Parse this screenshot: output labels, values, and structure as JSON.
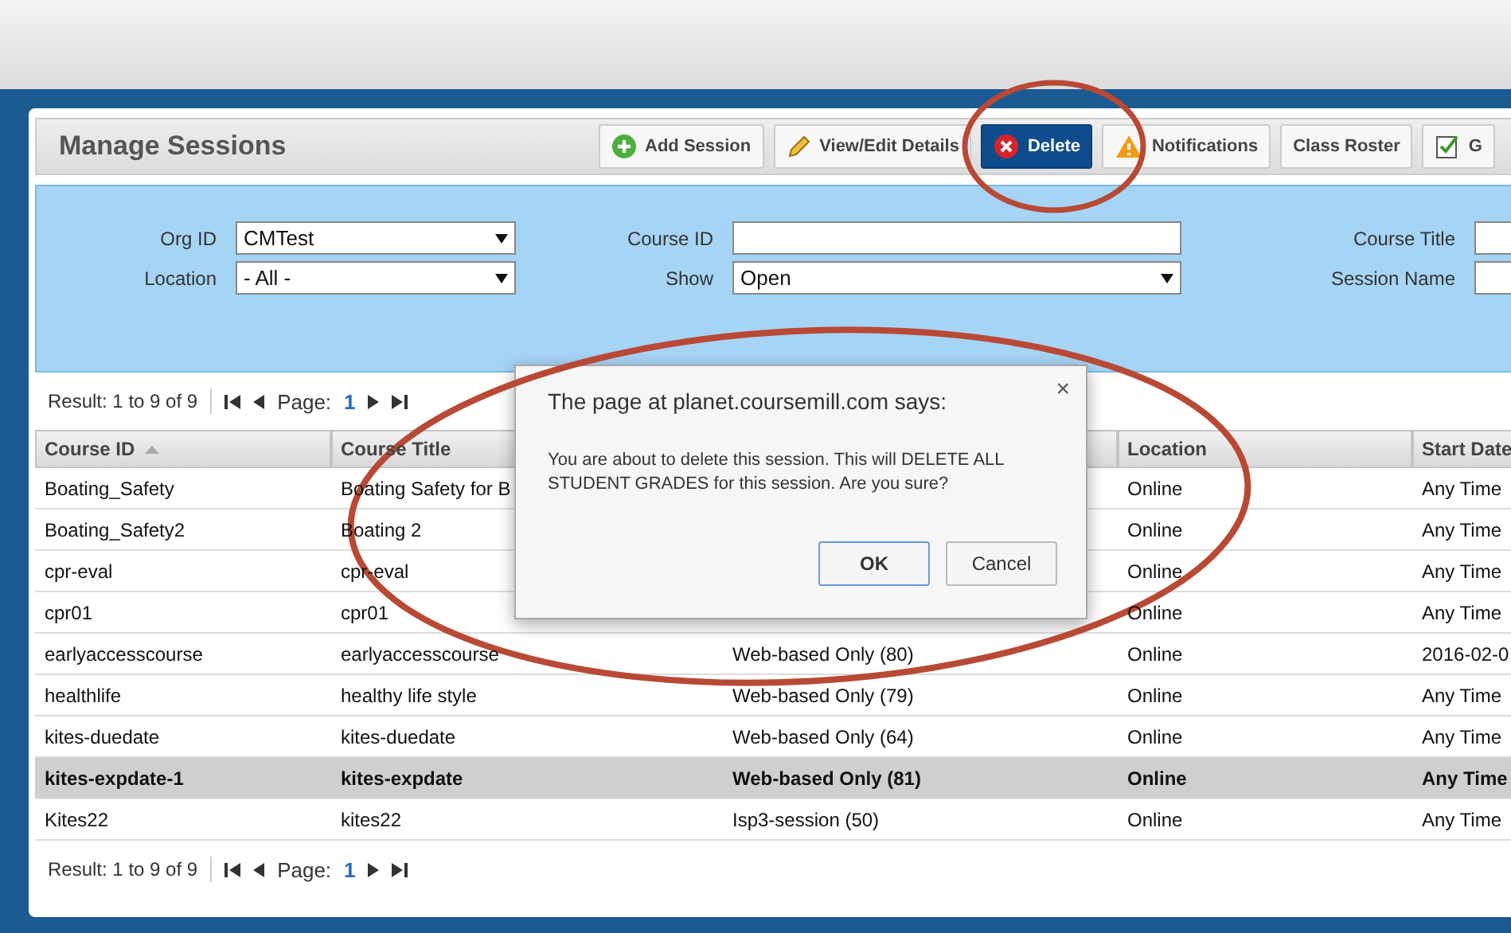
{
  "page_title": "Manage Sessions",
  "toolbar": [
    {
      "label": "Add Session",
      "selected": false
    },
    {
      "label": "View/Edit Details",
      "selected": false
    },
    {
      "label": "Delete",
      "selected": true
    },
    {
      "label": "Notifications",
      "selected": false
    },
    {
      "label": "Class Roster",
      "selected": false
    },
    {
      "label": "G",
      "selected": false
    }
  ],
  "filters": [
    {
      "label": "Org ID",
      "kind": "select",
      "value": "CMTest"
    },
    {
      "label": "Course ID",
      "kind": "input"
    },
    {
      "label": "Course Title",
      "kind": "input"
    },
    {
      "label": "Location",
      "kind": "select",
      "value": "- All -"
    },
    {
      "label": "Show",
      "kind": "select",
      "value": "Open"
    },
    {
      "label": "Session Name",
      "kind": "input"
    }
  ],
  "pager_top": {
    "result": "Result: 1 to 9 of 9",
    "page_label": "Page:",
    "page": "1"
  },
  "table": {
    "columns": [
      {
        "label": "Course ID",
        "sorted": true
      },
      {
        "label": "Course Title",
        "sorted": false
      },
      {},
      {
        "label": "Location",
        "sorted": false
      },
      {
        "label": "Start Date"
      }
    ],
    "rows": [
      {
        "cells": [
          "Boating_Safety",
          "Boating Safety for B",
          "",
          "Online",
          "Any Time"
        ],
        "selected": false
      },
      {
        "cells": [
          "Boating_Safety2",
          "Boating 2",
          "",
          "Online",
          "Any Time"
        ],
        "selected": false
      },
      {
        "cells": [
          "cpr-eval",
          "cpr-eval",
          "",
          "Online",
          "Any Time"
        ],
        "selected": false
      },
      {
        "cells": [
          "cpr01",
          "cpr01",
          "",
          "Online",
          "Any Time"
        ],
        "selected": false
      },
      {
        "cells": [
          "earlyaccesscourse",
          "earlyaccesscourse",
          "Web-based Only (80)",
          "Online",
          "2016-02-0"
        ],
        "selected": false
      },
      {
        "cells": [
          "healthlife",
          "healthy life style",
          "Web-based Only (79)",
          "Online",
          "Any Time"
        ],
        "selected": false
      },
      {
        "cells": [
          "kites-duedate",
          "kites-duedate",
          "Web-based Only (64)",
          "Online",
          "Any Time"
        ],
        "selected": false
      },
      {
        "cells": [
          "kites-expdate-1",
          "kites-expdate",
          "Web-based Only (81)",
          "Online",
          "Any Time"
        ],
        "selected": true
      },
      {
        "cells": [
          "Kites22",
          "kites22",
          "Isp3-session (50)",
          "Online",
          "Any Time"
        ],
        "selected": false
      }
    ]
  },
  "pager_bottom": {
    "result": "Result: 1 to 9 of 9",
    "page_label": "Page:",
    "page": "1"
  },
  "dialog": {
    "title": "The page at planet.coursemill.com says:",
    "close": "×",
    "message": "You are about to delete this session. This will DELETE ALL STUDENT GRADES for this session. Are you sure?",
    "ok": "OK",
    "cancel": "Cancel"
  }
}
